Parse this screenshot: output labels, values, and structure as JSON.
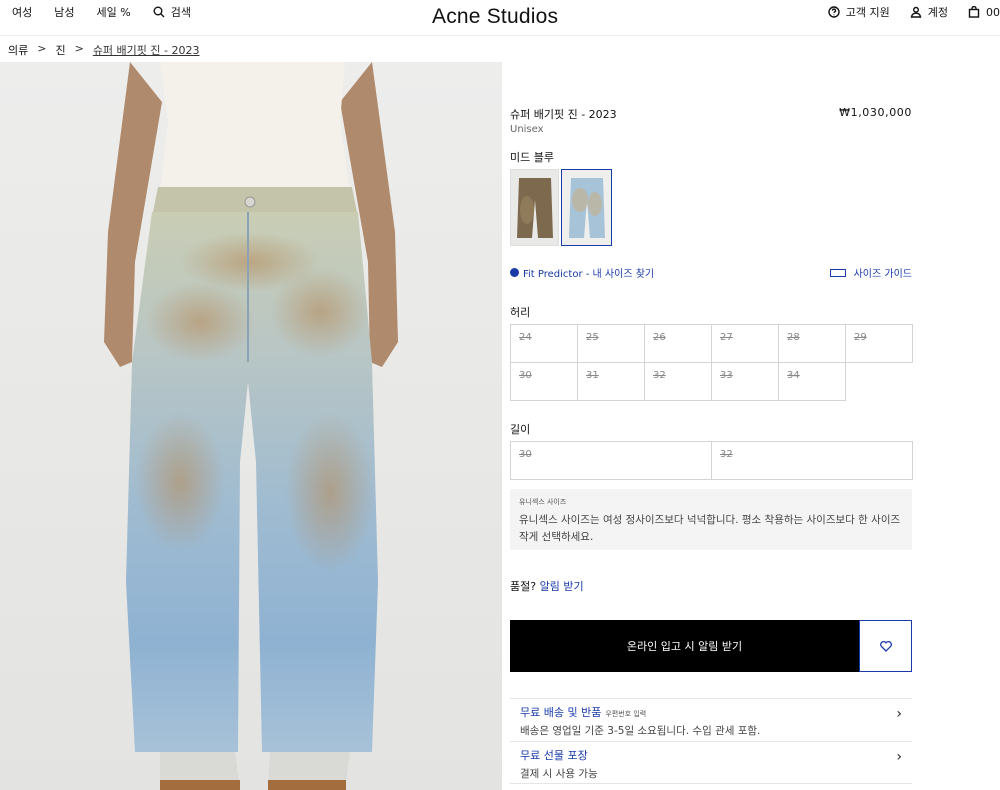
{
  "header": {
    "nav": [
      "여성",
      "남성",
      "세일 %"
    ],
    "search": "검색",
    "logo": "Acne Studios",
    "support": "고객 지원",
    "account": "계정",
    "cart": "00"
  },
  "breadcrumb": {
    "items": [
      "의류",
      "진"
    ],
    "current": "슈퍼 배기핏 진 - 2023",
    "sep": ">"
  },
  "product": {
    "name": "슈퍼 배기핏 진 - 2023",
    "price": "₩1,030,000",
    "gender": "Unisex",
    "color": "미드 블루",
    "fit_predictor": "Fit Predictor - 내 사이즈 찾기",
    "size_guide": "사이즈 가이드",
    "waist_label": "허리",
    "waist_sizes": [
      "24",
      "25",
      "26",
      "27",
      "28",
      "29",
      "30",
      "31",
      "32",
      "33",
      "34"
    ],
    "length_label": "길이",
    "length_sizes": [
      "30",
      "32"
    ],
    "note_title": "유니섹스 사이즈",
    "note_body": "유니섹스 사이즈는 여성 정사이즈보다 넉넉합니다. 평소 착용하는 사이즈보다 한 사이즈 작게 선택하세요.",
    "stock_q": "품절?",
    "stock_link": "알림 받기",
    "notify_button": "온라인 입고 시 알림 받기"
  },
  "info_rows": [
    {
      "title": "무료 배송 및 반품",
      "small": "우편번호 입력",
      "sub": "배송은 영업일 기준 3-5일 소요됩니다. 수입 관세 포함."
    },
    {
      "title": "무료 선물 포장",
      "small": "",
      "sub": "결제 시 사용 가능"
    }
  ],
  "colors": {
    "accent": "#1a3aa8",
    "button": "#000000"
  }
}
